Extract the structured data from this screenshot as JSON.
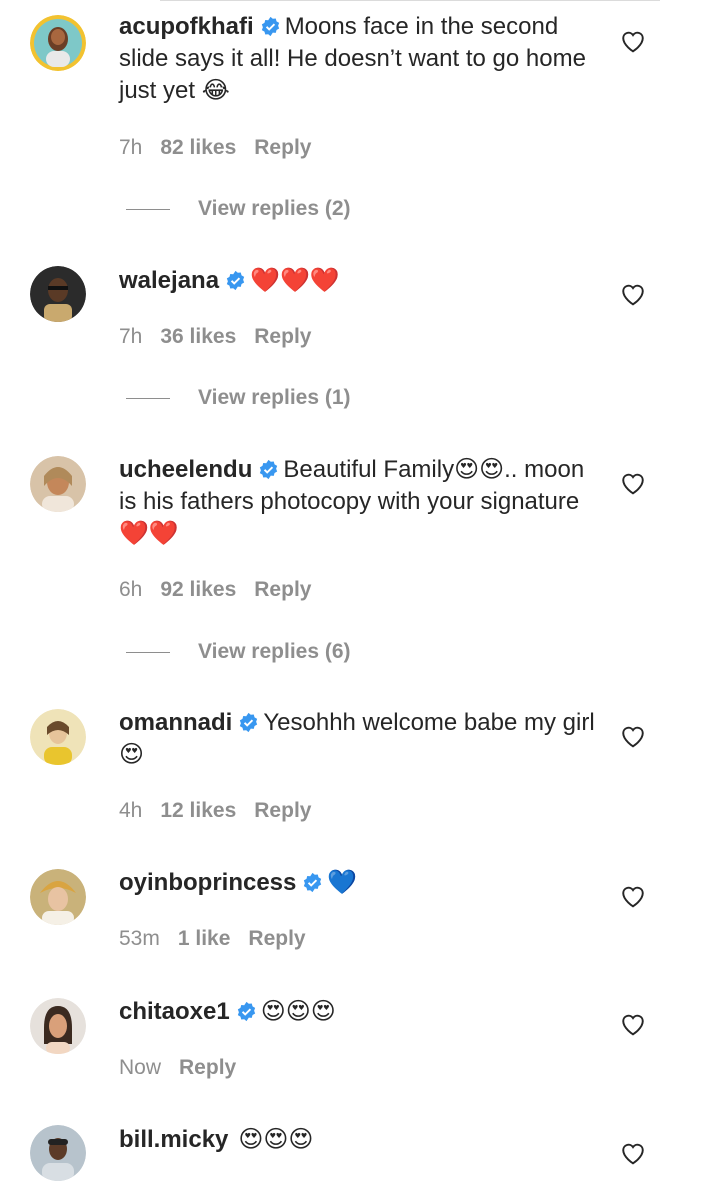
{
  "comments": [
    {
      "username": "acupofkhafi",
      "verified": true,
      "text": "Moons face in the second slide says it all! He doesn’t want to go home just yet 😂",
      "time": "7h",
      "likes": "82 likes",
      "reply": "Reply",
      "view_replies": "View replies (2)"
    },
    {
      "username": "walejana",
      "verified": true,
      "text": "❤️❤️❤️",
      "time": "7h",
      "likes": "36 likes",
      "reply": "Reply",
      "view_replies": "View replies (1)"
    },
    {
      "username": "ucheelendu",
      "verified": true,
      "text": "Beautiful Family😍😍.. moon is his fathers photocopy with your signature❤️❤️",
      "time": "6h",
      "likes": "92 likes",
      "reply": "Reply",
      "view_replies": "View replies (6)"
    },
    {
      "username": "omannadi",
      "verified": true,
      "text": "Yesohhh welcome babe my girl 😍",
      "time": "4h",
      "likes": "12 likes",
      "reply": "Reply"
    },
    {
      "username": "oyinboprincess",
      "verified": true,
      "text": "💙",
      "time": "53m",
      "likes": "1 like",
      "reply": "Reply"
    },
    {
      "username": "chitaoxe1",
      "verified": true,
      "text": "😍😍😍",
      "time": "Now",
      "reply": "Reply"
    },
    {
      "username": "bill.micky",
      "verified": false,
      "text": "😍😍😍"
    }
  ],
  "colors": {
    "text": "#262626",
    "secondary": "#8e8e8e",
    "verified_badge": "#3897f0"
  },
  "icons": {
    "verified": "verified-badge-icon",
    "like": "heart-outline-icon"
  }
}
